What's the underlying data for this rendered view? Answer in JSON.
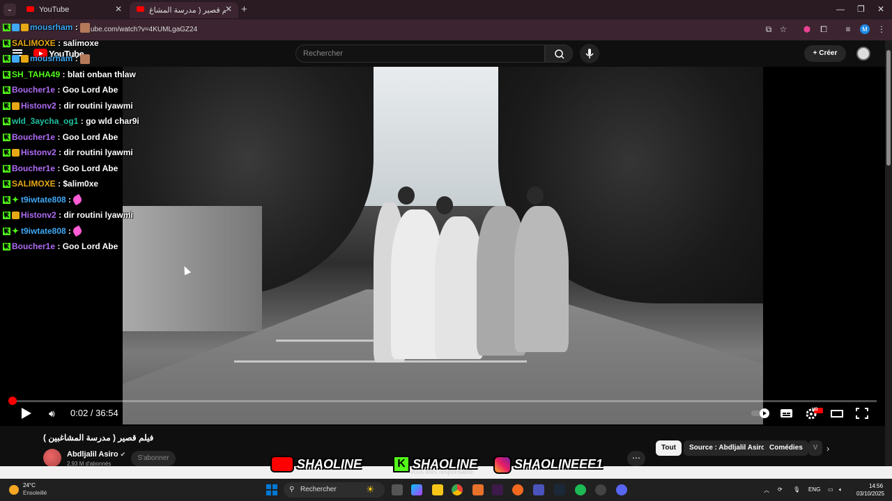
{
  "browser": {
    "tabs": [
      {
        "title": "YouTube",
        "active": false
      },
      {
        "title": "فيلم قصير ( مدرسة المشاغ...",
        "active": true
      }
    ],
    "url": "ube.com/watch?v=4KUMLgaGZ24",
    "profile_initial": "M"
  },
  "youtube": {
    "logo_text": "YouTube",
    "search_placeholder": "Rechercher",
    "create_label": "Créer"
  },
  "player": {
    "time": "0:02 / 36:54",
    "progress": 0.001,
    "quality_badge": "HD"
  },
  "chat": [
    {
      "user": "mousrham",
      "text": "",
      "color": "#3fa9f5",
      "badges": [
        "kick",
        "blue",
        "crown"
      ],
      "emote": "box"
    },
    {
      "user": "SALIMOXE",
      "text": "salimoxe",
      "color": "#e6a815",
      "badges": [
        "kick"
      ]
    },
    {
      "user": "mousrham",
      "text": "",
      "color": "#3fa9f5",
      "badges": [
        "kick",
        "blue",
        "crown"
      ],
      "emote": "box"
    },
    {
      "user": "SH_TAHA49",
      "text": "blati onban thlaw",
      "color": "#53fc18",
      "badges": [
        "kick"
      ]
    },
    {
      "user": "Boucher1e",
      "text": "Goo Lord Abe",
      "color": "#b06cf5",
      "badges": [
        "kick"
      ]
    },
    {
      "user": "Histonv2",
      "text": "dir routini lyawmi",
      "color": "#b06cf5",
      "badges": [
        "kick",
        "crown"
      ]
    },
    {
      "user": "wld_3aycha_og1",
      "text": "go wld char9i",
      "color": "#1ec0a0",
      "badges": [
        "kick"
      ]
    },
    {
      "user": "Boucher1e",
      "text": "Goo Lord Abe",
      "color": "#b06cf5",
      "badges": [
        "kick"
      ]
    },
    {
      "user": "Histonv2",
      "text": "dir routini lyawmi",
      "color": "#b06cf5",
      "badges": [
        "kick",
        "crown"
      ]
    },
    {
      "user": "Boucher1e",
      "text": "Goo Lord Abe",
      "color": "#b06cf5",
      "badges": [
        "kick"
      ]
    },
    {
      "user": "SALIMOXE",
      "text": "$alim0xe",
      "color": "#e6a815",
      "badges": [
        "kick"
      ]
    },
    {
      "user": "t9iwtate808",
      "text": "",
      "color": "#3fa9f5",
      "badges": [
        "kick",
        "star"
      ],
      "emote": "pink"
    },
    {
      "user": "Histonv2",
      "text": "dir routini lyawmi",
      "color": "#b06cf5",
      "badges": [
        "kick",
        "crown"
      ]
    },
    {
      "user": "t9iwtate808",
      "text": "",
      "color": "#3fa9f5",
      "badges": [
        "kick",
        "star"
      ],
      "emote": "pink"
    },
    {
      "user": "Boucher1e",
      "text": "Goo Lord Abe",
      "color": "#b06cf5",
      "badges": [
        "kick"
      ]
    }
  ],
  "video": {
    "title": "فيلم قصير ( مدرسة المشاغبين )",
    "channel": "Abdljalil Asiro",
    "subscribers": "2,93 M d'abonnés",
    "subscribe_label": "S'abonner",
    "more_label": "⋯"
  },
  "chips": [
    {
      "label": "Tout",
      "active": true
    },
    {
      "label": "Source : Abdljalil Asiro",
      "active": false
    },
    {
      "label": "Comédies",
      "active": false
    },
    {
      "label": "V",
      "active": false
    }
  ],
  "banner": {
    "youtube_name": "SHAOLINE",
    "kick_name": "SHAOLINE",
    "instagram_name": "SHAOLINEEE1",
    "responsible_text": "Vous êtes responsable"
  },
  "taskbar": {
    "temperature": "24°C",
    "weather": "Ensoleillé",
    "search_label": "Rechercher",
    "language": "ENG",
    "time": "14:56",
    "date": "03/10/2025"
  }
}
